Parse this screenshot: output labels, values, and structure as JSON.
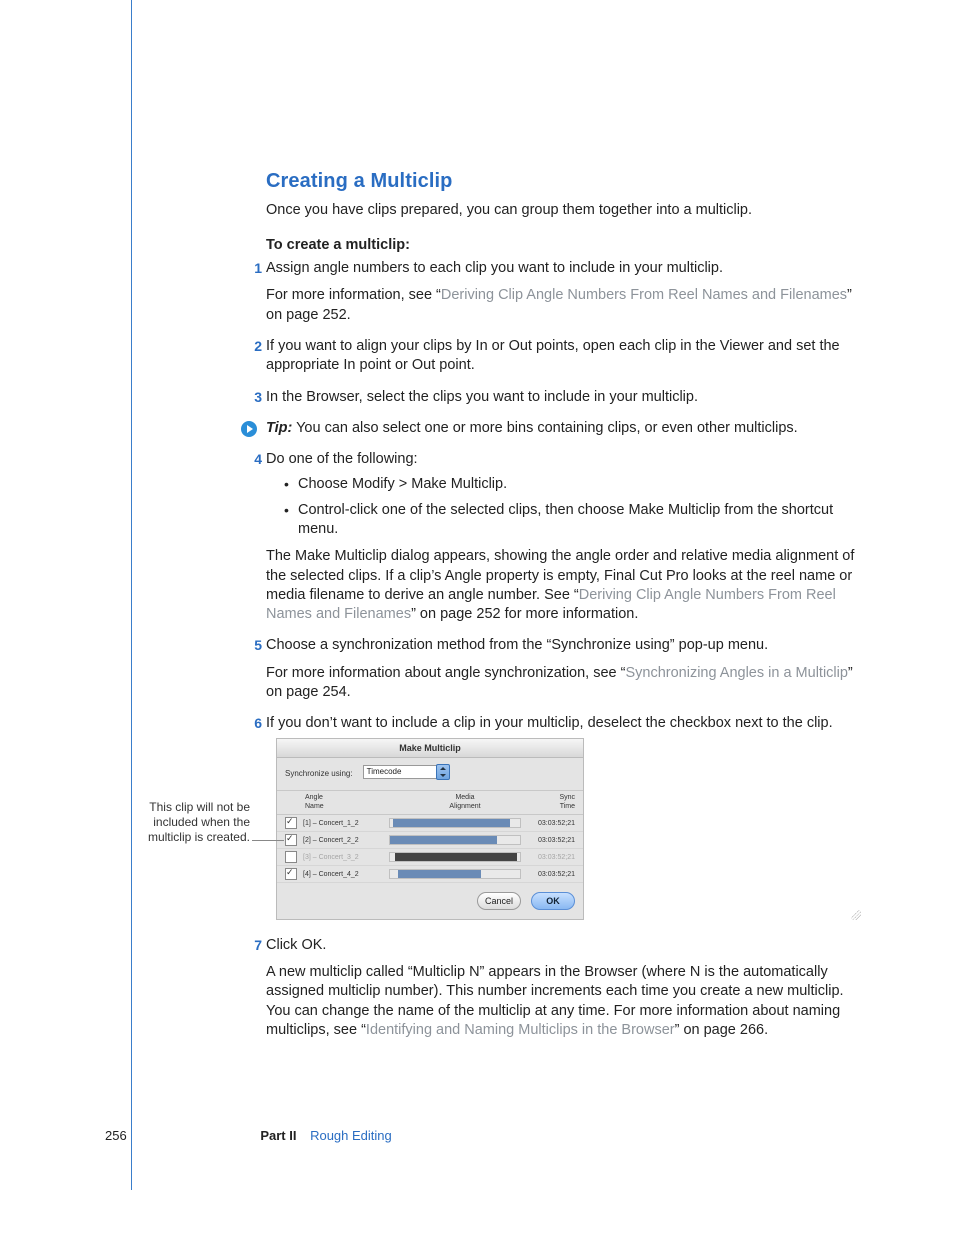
{
  "heading": "Creating a Multiclip",
  "intro": "Once you have clips prepared, you can group them together into a multiclip.",
  "subhead": "To create a multiclip:",
  "steps": {
    "s1_text": "Assign angle numbers to each clip you want to include in your multiclip.",
    "s1_more_pre": "For more information, see “",
    "s1_more_link": "Deriving Clip Angle Numbers From Reel Names and Filenames",
    "s1_more_post": "” on page 252.",
    "s2_text": "If you want to align your clips by In or Out points, open each clip in the Viewer and set the appropriate In point or Out point.",
    "s3_text": "In the Browser, select the clips you want to include in your multiclip.",
    "tip_label": "Tip:",
    "tip_text": "  You can also select one or more bins containing clips, or even other multiclips.",
    "s4_text": "Do one of the following:",
    "s4_b1": "Choose Modify > Make Multiclip.",
    "s4_b2": "Control-click one of the selected clips, then choose Make Multiclip from the shortcut menu.",
    "s4_after_pre": "The Make Multiclip dialog appears, showing the angle order and relative media alignment of the selected clips. If a clip’s Angle property is empty, Final Cut Pro looks at the reel name or media filename to derive an angle number. See “",
    "s4_after_link": "Deriving Clip Angle Numbers From Reel Names and Filenames",
    "s4_after_post": "” on page 252 for more information.",
    "s5_text": "Choose a synchronization method from the “Synchronize using” pop-up menu.",
    "s5_more_pre": "For more information about angle synchronization, see “",
    "s5_more_link": "Synchronizing Angles in a Multiclip",
    "s5_more_post": "” on page 254.",
    "s6_text": "If you don’t want to include a clip in your multiclip, deselect the checkbox next to the clip.",
    "s7_text": "Click OK.",
    "s7_after_pre": "A new multiclip called “Multiclip N” appears in the Browser (where N is the automatically assigned multiclip number). This number increments each time you create a new multiclip. You can change the name of the multiclip at any time. For more information about naming multiclips, see “",
    "s7_after_link": "Identifying and Naming Multiclips in the Browser",
    "s7_after_post": "” on page 266."
  },
  "step_nums": {
    "n1": "1",
    "n2": "2",
    "n3": "3",
    "n4": "4",
    "n5": "5",
    "n6": "6",
    "n7": "7"
  },
  "callout": "This clip will not be included when the multiclip is created.",
  "dialog": {
    "title": "Make Multiclip",
    "sync_label": "Synchronize using:",
    "sync_value": "Timecode",
    "col_angle_l1": "Angle",
    "col_angle_l2": "Name",
    "col_media_l1": "Media",
    "col_media_l2": "Alignment",
    "col_sync_l1": "Sync",
    "col_sync_l2": "Time",
    "rows": {
      "r1_name": "[1] – Concert_1_2",
      "r1_time": "03:03:52;21",
      "r2_name": "[2] – Concert_2_2",
      "r2_time": "03:03:52;21",
      "r3_name": "[3] – Concert_3_2",
      "r3_time": "03:03:52;21",
      "r4_name": "[4] – Concert_4_2",
      "r4_time": "03:03:52;21"
    },
    "cancel": "Cancel",
    "ok": "OK"
  },
  "footer": {
    "pageno": "256",
    "part": "Part II",
    "section": "Rough Editing"
  }
}
